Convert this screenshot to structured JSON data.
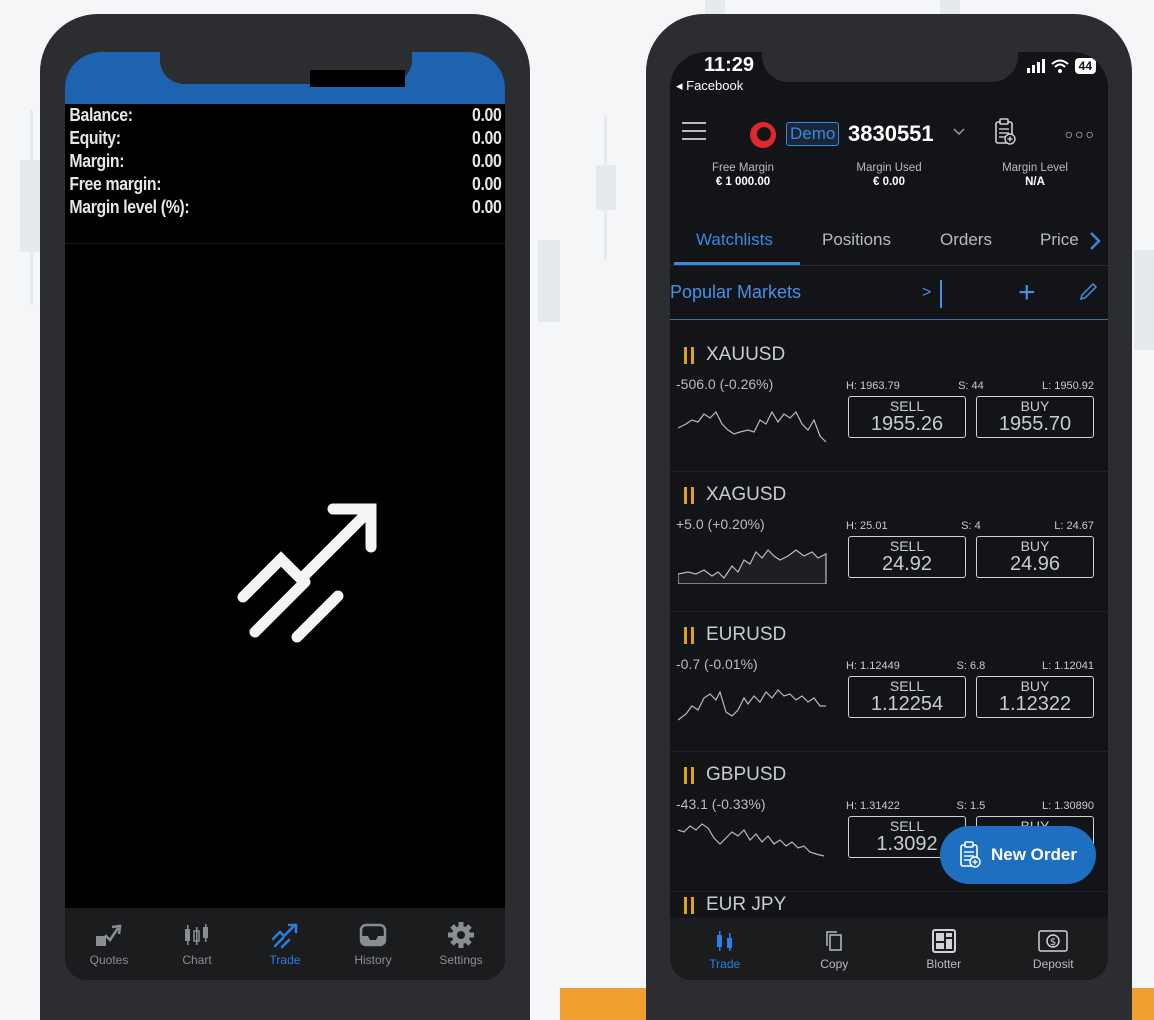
{
  "left": {
    "account": [
      {
        "label": "Balance:",
        "value": "0.00"
      },
      {
        "label": "Equity:",
        "value": "0.00"
      },
      {
        "label": "Margin:",
        "value": "0.00"
      },
      {
        "label": "Free margin:",
        "value": "0.00"
      },
      {
        "label": "Margin level (%):",
        "value": "0.00"
      }
    ],
    "tabs": [
      {
        "label": "Quotes",
        "icon": "quotes-icon"
      },
      {
        "label": "Chart",
        "icon": "chart-icon"
      },
      {
        "label": "Trade",
        "icon": "trade-icon",
        "active": true
      },
      {
        "label": "History",
        "icon": "history-icon"
      },
      {
        "label": "Settings",
        "icon": "gear-icon"
      }
    ]
  },
  "right": {
    "status": {
      "time": "11:29",
      "back": "◂ Facebook",
      "battery": "44"
    },
    "header": {
      "badge": "Demo",
      "account_number": "3830551"
    },
    "margins": [
      {
        "label": "Free Margin",
        "value": "€ 1 000.00"
      },
      {
        "label": "Margin Used",
        "value": "€ 0.00"
      },
      {
        "label": "Margin Level",
        "value": "N/A"
      }
    ],
    "tabs": {
      "watchlists": "Watchlists",
      "positions": "Positions",
      "orders": "Orders",
      "price": "Price"
    },
    "watchlist": {
      "name": "Popular Markets",
      "next": ">",
      "plus": "+"
    },
    "quotes": [
      {
        "symbol": "XAUUSD",
        "change": "-506.0 (-0.26%)",
        "high": "H: 1963.79",
        "spread": "S: 44",
        "low": "L: 1950.92",
        "sell_label": "SELL",
        "sell": "1955.26",
        "buy_label": "BUY",
        "buy": "1955.70"
      },
      {
        "symbol": "XAGUSD",
        "change": "+5.0 (+0.20%)",
        "high": "H: 25.01",
        "spread": "S: 4",
        "low": "L: 24.67",
        "sell_label": "SELL",
        "sell": "24.92",
        "buy_label": "BUY",
        "buy": "24.96"
      },
      {
        "symbol": "EURUSD",
        "change": "-0.7 (-0.01%)",
        "high": "H: 1.12449",
        "spread": "S: 6.8",
        "low": "L: 1.12041",
        "sell_label": "SELL",
        "sell": "1.12254",
        "buy_label": "BUY",
        "buy": "1.12322"
      },
      {
        "symbol": "GBPUSD",
        "change": "-43.1 (-0.33%)",
        "high": "H: 1.31422",
        "spread": "S: 1.5",
        "low": "L: 1.30890",
        "sell_label": "SELL",
        "sell": "1.3092",
        "buy_label": "BUY",
        "buy": ""
      }
    ],
    "partial_symbol": "EUR JPY",
    "new_order": "New Order",
    "bottom_tabs": [
      {
        "label": "Trade",
        "icon": "candles-icon",
        "active": true
      },
      {
        "label": "Copy",
        "icon": "copy-icon"
      },
      {
        "label": "Blotter",
        "icon": "blotter-icon"
      },
      {
        "label": "Deposit",
        "icon": "deposit-icon"
      }
    ]
  }
}
